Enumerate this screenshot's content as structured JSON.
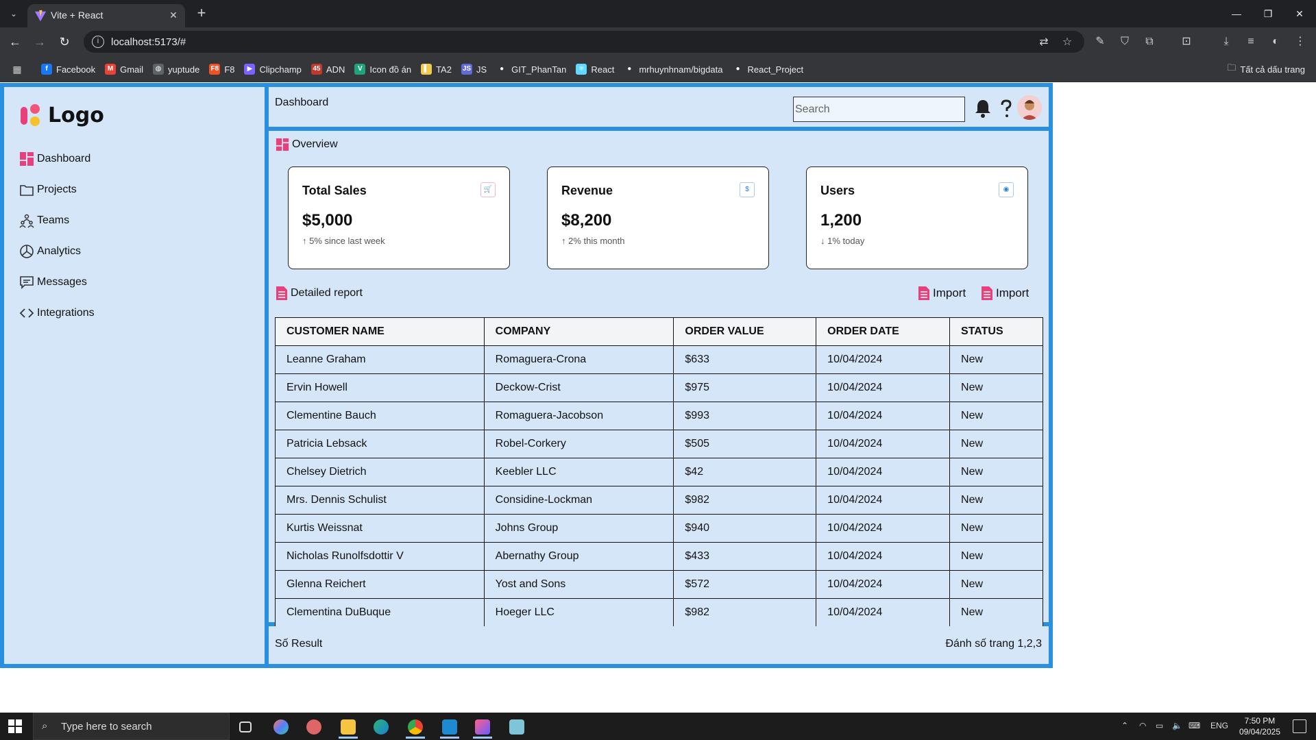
{
  "browser": {
    "tab_title": "Vite + React",
    "url": "localhost:5173/#",
    "bookmarks": [
      {
        "label": "Facebook",
        "icon": "facebook-icon",
        "color": "#1877f2",
        "glyph": "f"
      },
      {
        "label": "Gmail",
        "icon": "gmail-icon",
        "color": "#ea4335",
        "glyph": "M"
      },
      {
        "label": "yuptude",
        "icon": "globe-icon",
        "color": "#5f6368",
        "glyph": "◍"
      },
      {
        "label": "F8",
        "icon": "f8-icon",
        "color": "#f05123",
        "glyph": "F8"
      },
      {
        "label": "Clipchamp",
        "icon": "clipchamp-icon",
        "color": "#7b61ff",
        "glyph": "▶"
      },
      {
        "label": "ADN",
        "icon": "adn-icon",
        "color": "#c0392b",
        "glyph": "45"
      },
      {
        "label": "Icon đồ án",
        "icon": "vuetify-icon",
        "color": "#1fa37b",
        "glyph": "V"
      },
      {
        "label": "TA2",
        "icon": "bookmark-folder-icon",
        "color": "#f2c94c",
        "glyph": "▌"
      },
      {
        "label": "JS",
        "icon": "js-icon",
        "color": "#5f6bd8",
        "glyph": "JS"
      },
      {
        "label": "GIT_PhanTan",
        "icon": "github-icon",
        "color": "#ffffff",
        "glyph": "●"
      },
      {
        "label": "React",
        "icon": "react-icon",
        "color": "#61dafb",
        "glyph": "⚛"
      },
      {
        "label": "mrhuynhnam/bigdata",
        "icon": "github-icon",
        "color": "#ffffff",
        "glyph": "●"
      },
      {
        "label": "React_Project",
        "icon": "github-icon",
        "color": "#ffffff",
        "glyph": "●"
      }
    ],
    "all_bookmarks_label": "Tất cả dấu trang"
  },
  "app": {
    "logo_text": "Logo",
    "nav": [
      {
        "label": "Dashboard",
        "icon": "dashboard-icon"
      },
      {
        "label": "Projects",
        "icon": "folder-icon"
      },
      {
        "label": "Teams",
        "icon": "teams-icon"
      },
      {
        "label": "Analytics",
        "icon": "analytics-icon"
      },
      {
        "label": "Messages",
        "icon": "messages-icon"
      },
      {
        "label": "Integrations",
        "icon": "code-icon"
      }
    ],
    "header": {
      "title": "Dashboard",
      "search_placeholder": "Search"
    },
    "overview_title": "Overview",
    "cards": [
      {
        "label": "Total Sales",
        "value": "$5,000",
        "delta": "↑ 5% since last week",
        "icon": "cart-icon",
        "icon_color": "#e8407a",
        "glyph": "🛒"
      },
      {
        "label": "Revenue",
        "value": "$8,200",
        "delta": "↑ 2% this month",
        "icon": "dollar-icon",
        "icon_color": "#2b7fd8",
        "glyph": "$"
      },
      {
        "label": "Users",
        "value": "1,200",
        "delta": "↓ 1% today",
        "icon": "user-circle-icon",
        "icon_color": "#2b7fd8",
        "glyph": "◉"
      }
    ],
    "report_title": "Detailed report",
    "import_label_1": "Import",
    "import_label_2": "Import",
    "table": {
      "columns": [
        "CUSTOMER NAME",
        "COMPANY",
        "ORDER VALUE",
        "ORDER DATE",
        "STATUS"
      ],
      "rows": [
        [
          "Leanne Graham",
          "Romaguera-Crona",
          "$633",
          "10/04/2024",
          "New"
        ],
        [
          "Ervin Howell",
          "Deckow-Crist",
          "$975",
          "10/04/2024",
          "New"
        ],
        [
          "Clementine Bauch",
          "Romaguera-Jacobson",
          "$993",
          "10/04/2024",
          "New"
        ],
        [
          "Patricia Lebsack",
          "Robel-Corkery",
          "$505",
          "10/04/2024",
          "New"
        ],
        [
          "Chelsey Dietrich",
          "Keebler LLC",
          "$42",
          "10/04/2024",
          "New"
        ],
        [
          "Mrs. Dennis Schulist",
          "Considine-Lockman",
          "$982",
          "10/04/2024",
          "New"
        ],
        [
          "Kurtis Weissnat",
          "Johns Group",
          "$940",
          "10/04/2024",
          "New"
        ],
        [
          "Nicholas Runolfsdottir V",
          "Abernathy Group",
          "$433",
          "10/04/2024",
          "New"
        ],
        [
          "Glenna Reichert",
          "Yost and Sons",
          "$572",
          "10/04/2024",
          "New"
        ],
        [
          "Clementina DuBuque",
          "Hoeger LLC",
          "$982",
          "10/04/2024",
          "New"
        ]
      ]
    },
    "footer_left": "Số Result",
    "footer_right": "Đánh số trang 1,2,3",
    "colors": {
      "accent": "#2b8fe0",
      "panel": "#d4e6f8",
      "pink": "#e8407a"
    }
  },
  "taskbar": {
    "search_placeholder": "Type here to search",
    "language": "ENG",
    "time": "7:50 PM",
    "date": "09/04/2025"
  }
}
